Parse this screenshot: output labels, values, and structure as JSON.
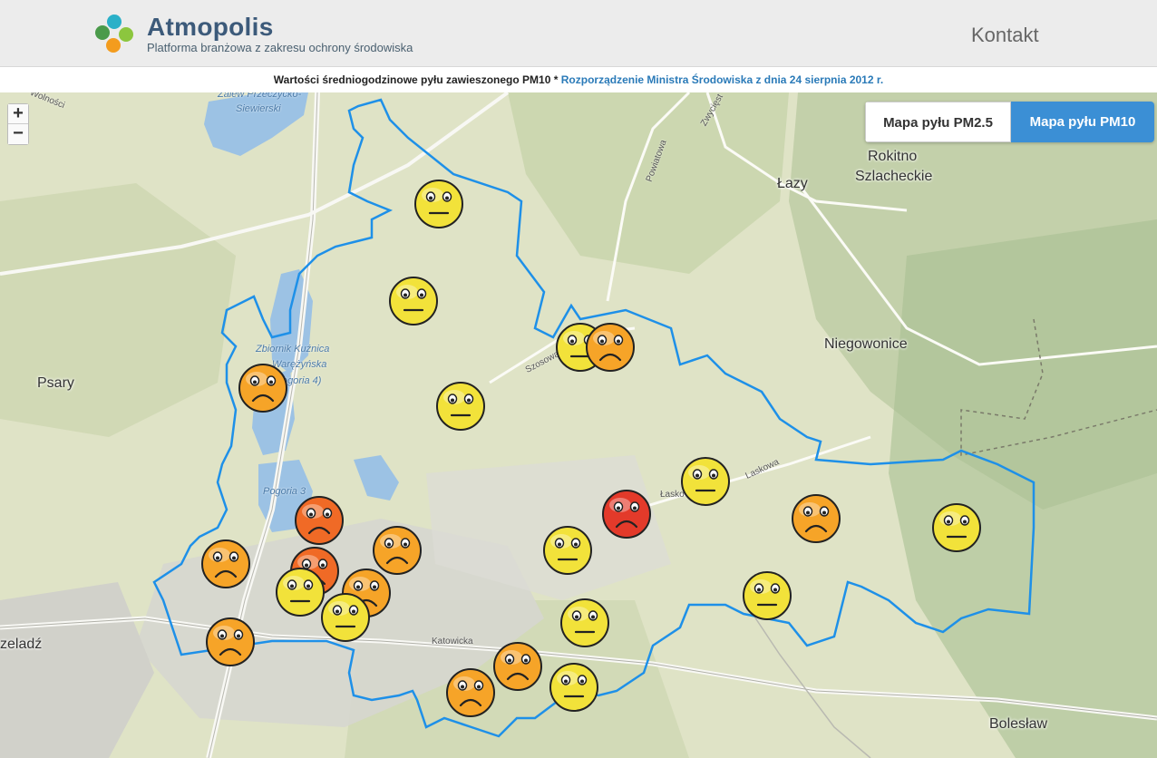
{
  "header": {
    "title": "Atmopolis",
    "subtitle": "Platforma branżowa z zakresu ochrony środowiska",
    "nav_contact": "Kontakt",
    "logo_colors": [
      "#2ab0c8",
      "#8cc63e",
      "#f39c1e",
      "#4a9a4a"
    ]
  },
  "info": {
    "text": "Wartości średniogodzinowe pyłu zawieszonego PM10 *",
    "link": "Rozporządzenie Ministra Środowiska z dnia 24 sierpnia 2012 r."
  },
  "controls": {
    "zoom_in": "+",
    "zoom_out": "−",
    "pm25": "Mapa pyłu PM2.5",
    "pm10": "Mapa pyłu PM10",
    "active": "pm10"
  },
  "map": {
    "places": [
      "Rokitno",
      "Szlacheckie",
      "Łazy",
      "Psary",
      "Niegowonice",
      "Bolesław",
      "zeladź"
    ],
    "roads": [
      "Wolności",
      "Powiatowa",
      "Zwycięst",
      "Szosowa",
      "Laskowa",
      "Łasko",
      "Katowicka"
    ],
    "water": [
      "Zalew Przeczycko-",
      "Siewierski",
      "Zbiornik Kuźnica",
      "Warężyńska",
      "(Pogoria 4)",
      "Pogoria 3"
    ],
    "colors": {
      "boundary": "#1e90e8",
      "neutral": "#f2e23a",
      "sad": "#f6a428",
      "bad": "#f06a26",
      "very_bad": "#e33a2a"
    }
  },
  "markers": [
    {
      "mood": "neutral",
      "lng": 19.32,
      "lat": 50.55
    },
    {
      "mood": "neutral",
      "lng": 19.3,
      "lat": 50.52
    },
    {
      "mood": "neutral",
      "lng": 19.37,
      "lat": 50.5
    },
    {
      "mood": "sad",
      "lng": 19.39,
      "lat": 50.5
    },
    {
      "mood": "sad",
      "lng": 19.27,
      "lat": 50.49
    },
    {
      "mood": "neutral",
      "lng": 19.31,
      "lat": 50.48
    },
    {
      "mood": "neutral",
      "lng": 19.45,
      "lat": 50.47
    },
    {
      "mood": "very_bad",
      "lng": 19.42,
      "lat": 50.46
    },
    {
      "mood": "sad",
      "lng": 19.5,
      "lat": 50.46
    },
    {
      "mood": "neutral",
      "lng": 19.58,
      "lat": 50.45
    },
    {
      "mood": "bad",
      "lng": 19.28,
      "lat": 50.46
    },
    {
      "mood": "sad",
      "lng": 19.3,
      "lat": 50.45
    },
    {
      "mood": "sad",
      "lng": 19.25,
      "lat": 50.45
    },
    {
      "mood": "neutral",
      "lng": 19.37,
      "lat": 50.45
    },
    {
      "mood": "bad",
      "lng": 19.28,
      "lat": 50.44
    },
    {
      "mood": "neutral",
      "lng": 19.27,
      "lat": 50.44
    },
    {
      "mood": "sad",
      "lng": 19.29,
      "lat": 50.44
    },
    {
      "mood": "neutral",
      "lng": 19.28,
      "lat": 50.43
    },
    {
      "mood": "neutral",
      "lng": 19.47,
      "lat": 50.44
    },
    {
      "mood": "neutral",
      "lng": 19.38,
      "lat": 50.43
    },
    {
      "mood": "sad",
      "lng": 19.25,
      "lat": 50.42
    },
    {
      "mood": "sad",
      "lng": 19.35,
      "lat": 50.42
    },
    {
      "mood": "neutral",
      "lng": 19.37,
      "lat": 50.41
    },
    {
      "mood": "sad",
      "lng": 19.33,
      "lat": 50.41
    }
  ]
}
